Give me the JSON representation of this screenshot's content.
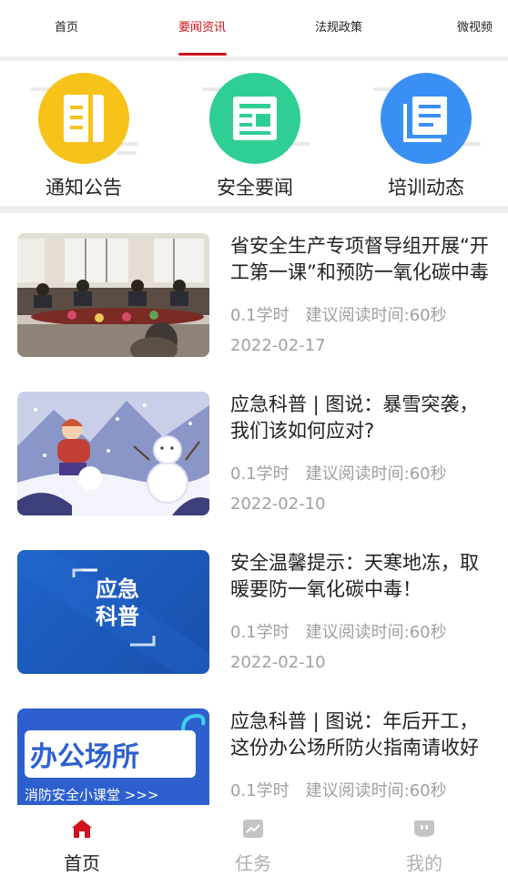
{
  "top_tabs": [
    {
      "label": "首页"
    },
    {
      "label": "要闻资讯"
    },
    {
      "label": "法规政策"
    },
    {
      "label": "微视频"
    }
  ],
  "active_tab_color": "#d0121b",
  "categories": [
    {
      "label": "通知公告",
      "icon": "notice-document-icon",
      "color": "#f7c21a"
    },
    {
      "label": "安全要闻",
      "icon": "news-card-icon",
      "color": "#2fce93"
    },
    {
      "label": "培训动态",
      "icon": "training-pages-icon",
      "color": "#3a8ff5"
    }
  ],
  "news": [
    {
      "title": "省安全生产专项督导组开展“开工第一课”和预防一氧化碳中毒",
      "hours": "0.1学时",
      "read_time": "建议阅读时间:60秒",
      "date": "2022-02-17"
    },
    {
      "title": "应急科普 | 图说：暴雪突袭，我们该如何应对?",
      "hours": "0.1学时",
      "read_time": "建议阅读时间:60秒",
      "date": "2022-02-10"
    },
    {
      "title": "安全温馨提示：天寒地冻，取暖要防一氧化碳中毒！",
      "hours": "0.1学时",
      "read_time": "建议阅读时间:60秒",
      "date": "2022-02-10",
      "thumb_text_line1": "应急",
      "thumb_text_line2": "科普"
    },
    {
      "title": "应急科普 | 图说：年后开工，这份办公场所防火指南请收好",
      "hours": "0.1学时",
      "read_time": "建议阅读时间:60秒",
      "thumb_text_big": "办公场所",
      "thumb_text_small": "消防安全小课堂 >>>"
    }
  ],
  "bottom_nav": [
    {
      "label": "首页",
      "icon": "home-icon"
    },
    {
      "label": "任务",
      "icon": "task-chart-icon"
    },
    {
      "label": "我的",
      "icon": "profile-icon"
    }
  ]
}
